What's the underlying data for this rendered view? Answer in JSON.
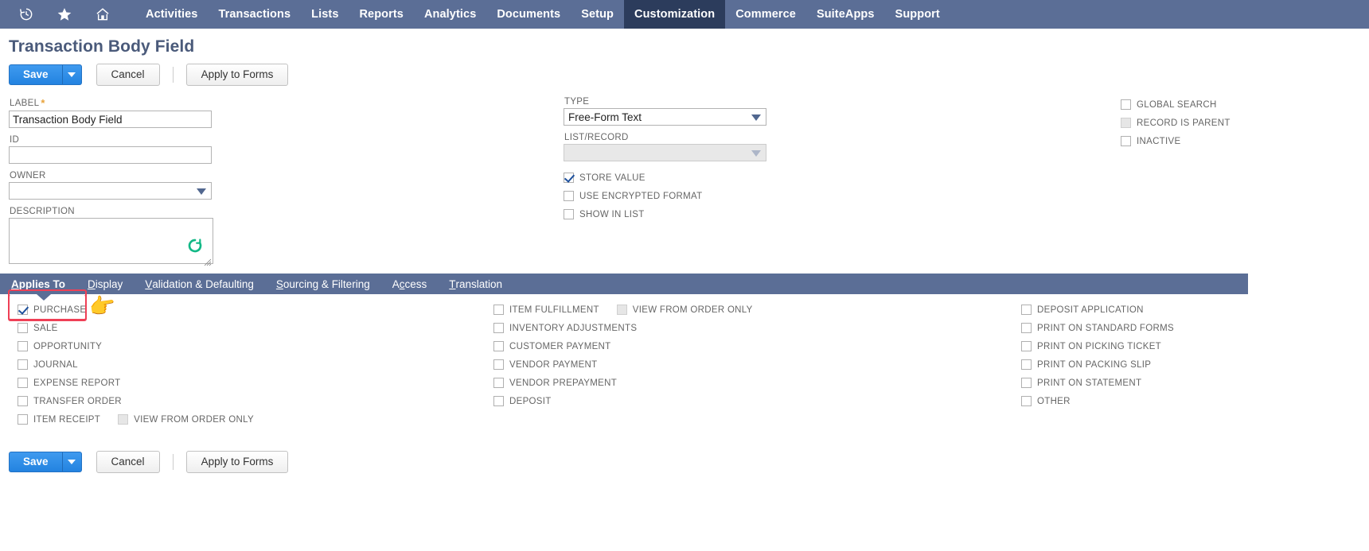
{
  "navbar": {
    "icons": [
      {
        "name": "recent-records-icon",
        "glyph": "↺"
      },
      {
        "name": "shortcuts-star-icon",
        "glyph": "★"
      },
      {
        "name": "home-icon",
        "glyph": "⌂"
      }
    ],
    "items": [
      {
        "label": "Activities",
        "active": false
      },
      {
        "label": "Transactions",
        "active": false
      },
      {
        "label": "Lists",
        "active": false
      },
      {
        "label": "Reports",
        "active": false
      },
      {
        "label": "Analytics",
        "active": false
      },
      {
        "label": "Documents",
        "active": false
      },
      {
        "label": "Setup",
        "active": false
      },
      {
        "label": "Customization",
        "active": true
      },
      {
        "label": "Commerce",
        "active": false
      },
      {
        "label": "SuiteApps",
        "active": false
      },
      {
        "label": "Support",
        "active": false
      }
    ],
    "bg_color": "#5b6e96",
    "active_bg_color": "#2c3c5c"
  },
  "page": {
    "title": "Transaction Body Field"
  },
  "toolbar": {
    "save_label": "Save",
    "cancel_label": "Cancel",
    "apply_to_forms_label": "Apply to Forms"
  },
  "toolbar_bottom": {
    "save_label": "Save",
    "cancel_label": "Cancel",
    "apply_to_forms_label": "Apply to Forms"
  },
  "form": {
    "left": {
      "label_caption": "LABEL",
      "label_value": "Transaction Body Field",
      "id_caption": "ID",
      "id_value": "",
      "owner_caption": "OWNER",
      "owner_value": "",
      "description_caption": "DESCRIPTION",
      "description_value": ""
    },
    "middle": {
      "type_caption": "TYPE",
      "type_value": "Free-Form Text",
      "listrecord_caption": "LIST/RECORD",
      "listrecord_value": "",
      "checkboxes": [
        {
          "label": "STORE VALUE",
          "checked": true,
          "disabled": false
        },
        {
          "label": "USE ENCRYPTED FORMAT",
          "checked": false,
          "disabled": false
        },
        {
          "label": "SHOW IN LIST",
          "checked": false,
          "disabled": false
        }
      ]
    },
    "right": {
      "checkboxes": [
        {
          "label": "GLOBAL SEARCH",
          "checked": false,
          "disabled": false
        },
        {
          "label": "RECORD IS PARENT",
          "checked": false,
          "disabled": true
        },
        {
          "label": "INACTIVE",
          "checked": false,
          "disabled": false
        }
      ]
    }
  },
  "tabs": [
    {
      "label": "Applies To",
      "accesskey": "A",
      "active": true
    },
    {
      "label": "Display",
      "accesskey": "D",
      "active": false
    },
    {
      "label": "Validation & Defaulting",
      "accesskey": "V",
      "active": false
    },
    {
      "label": "Sourcing & Filtering",
      "accesskey": "S",
      "active": false
    },
    {
      "label": "Access",
      "accesskey": "c",
      "active": false
    },
    {
      "label": "Translation",
      "accesskey": "T",
      "active": false
    }
  ],
  "applies_to": {
    "column_left": [
      {
        "label": "PURCHASE",
        "checked": true,
        "disabled": false
      },
      {
        "label": "SALE",
        "checked": false,
        "disabled": false
      },
      {
        "label": "OPPORTUNITY",
        "checked": false,
        "disabled": false
      },
      {
        "label": "JOURNAL",
        "checked": false,
        "disabled": false
      },
      {
        "label": "EXPENSE REPORT",
        "checked": false,
        "disabled": false
      },
      {
        "label": "TRANSFER ORDER",
        "checked": false,
        "disabled": false
      },
      {
        "label": "ITEM RECEIPT",
        "checked": false,
        "disabled": false,
        "secondary": {
          "label": "VIEW FROM ORDER ONLY",
          "checked": false,
          "disabled": true
        }
      }
    ],
    "column_middle": [
      {
        "label": "ITEM FULFILLMENT",
        "checked": false,
        "disabled": false,
        "secondary": {
          "label": "VIEW FROM ORDER ONLY",
          "checked": false,
          "disabled": true
        }
      },
      {
        "label": "INVENTORY ADJUSTMENTS",
        "checked": false,
        "disabled": false
      },
      {
        "label": "CUSTOMER PAYMENT",
        "checked": false,
        "disabled": false
      },
      {
        "label": "VENDOR PAYMENT",
        "checked": false,
        "disabled": false
      },
      {
        "label": "VENDOR PREPAYMENT",
        "checked": false,
        "disabled": false
      },
      {
        "label": "DEPOSIT",
        "checked": false,
        "disabled": false
      }
    ],
    "column_right": [
      {
        "label": "DEPOSIT APPLICATION",
        "checked": false,
        "disabled": false
      },
      {
        "label": "PRINT ON STANDARD FORMS",
        "checked": false,
        "disabled": false
      },
      {
        "label": "PRINT ON PICKING TICKET",
        "checked": false,
        "disabled": false
      },
      {
        "label": "PRINT ON PACKING SLIP",
        "checked": false,
        "disabled": false
      },
      {
        "label": "PRINT ON STATEMENT",
        "checked": false,
        "disabled": false
      },
      {
        "label": "OTHER",
        "checked": false,
        "disabled": false
      }
    ]
  },
  "annotations": {
    "highlight_color": "#ef4056",
    "cursor_glyph": "👉"
  },
  "colors": {
    "nav_bg": "#5b6e96",
    "nav_active": "#2c3c5c",
    "primary_button": "#2e8ce6",
    "title_text": "#4a5a7a",
    "checkmark": "#1c4f9c",
    "spinner_green": "#12b886"
  }
}
